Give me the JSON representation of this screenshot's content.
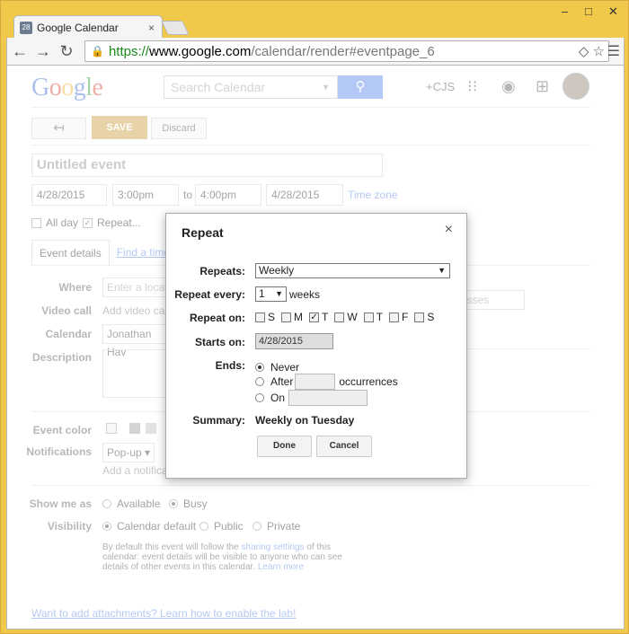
{
  "browser": {
    "tab_title": "Google Calendar",
    "tab_favicon_text": "28",
    "tab_close": "×",
    "url_scheme": "https://",
    "url_host": "www.google.com",
    "url_path": "/calendar/render#eventpage_6",
    "window_min": "–",
    "window_max": "□",
    "window_close": "✕"
  },
  "header": {
    "logo": [
      "G",
      "o",
      "o",
      "g",
      "l",
      "e"
    ],
    "search_placeholder": "Search Calendar",
    "plus_name": "+CJS"
  },
  "toolbar": {
    "back_label": "↤",
    "save_label": "SAVE",
    "discard_label": "Discard"
  },
  "event": {
    "title_placeholder": "Untitled event",
    "start_date": "4/28/2015",
    "start_time": "3:00pm",
    "to_label": "to",
    "end_time": "4:00pm",
    "end_date": "4/28/2015",
    "timezone_label": "Time zone",
    "all_day_label": "All day",
    "repeat_label": "Repeat...",
    "tabs": [
      "Event details",
      "Find a time"
    ],
    "where_label": "Where",
    "where_placeholder": "Enter a locati",
    "video_label": "Video call",
    "video_value": "Add video call",
    "calendar_label": "Calendar",
    "calendar_value": "Jonathan Hav",
    "description_label": "Description",
    "guests_placeholder": "esses",
    "event_color_label": "Event color",
    "notifications_label": "Notifications",
    "notification_type": "Pop-up ▾",
    "add_notification": "Add a notificat",
    "show_me_as_label": "Show me as",
    "show_options": [
      "Available",
      "Busy"
    ],
    "show_selected": "Busy",
    "visibility_label": "Visibility",
    "visibility_options": [
      "Calendar default",
      "Public",
      "Private"
    ],
    "visibility_selected": "Calendar default",
    "note_text": "By default this event will follow the ",
    "note_link": "sharing settings",
    "note_text2": " of this calendar: event details will be visible to anyone who can see details of other events in this calendar.",
    "note_learn": "Learn more",
    "attachments_text": "Want to add attachments? Learn how to enable the lab!"
  },
  "dialog": {
    "title": "Repeat",
    "close": "×",
    "repeats_label": "Repeats:",
    "repeats_value": "Weekly",
    "every_label": "Repeat every:",
    "every_value": "1",
    "every_unit": "weeks",
    "on_label": "Repeat on:",
    "days": [
      {
        "label": "S",
        "checked": false
      },
      {
        "label": "M",
        "checked": false
      },
      {
        "label": "T",
        "checked": true
      },
      {
        "label": "W",
        "checked": false
      },
      {
        "label": "T",
        "checked": false
      },
      {
        "label": "F",
        "checked": false
      },
      {
        "label": "S",
        "checked": false
      }
    ],
    "starts_label": "Starts on:",
    "starts_value": "4/28/2015",
    "ends_label": "Ends:",
    "ends_never": "Never",
    "ends_after": "After",
    "ends_occurrences": "occurrences",
    "ends_on": "On",
    "ends_selected": "Never",
    "summary_label": "Summary:",
    "summary_value": "Weekly on Tuesday",
    "done_label": "Done",
    "cancel_label": "Cancel"
  }
}
